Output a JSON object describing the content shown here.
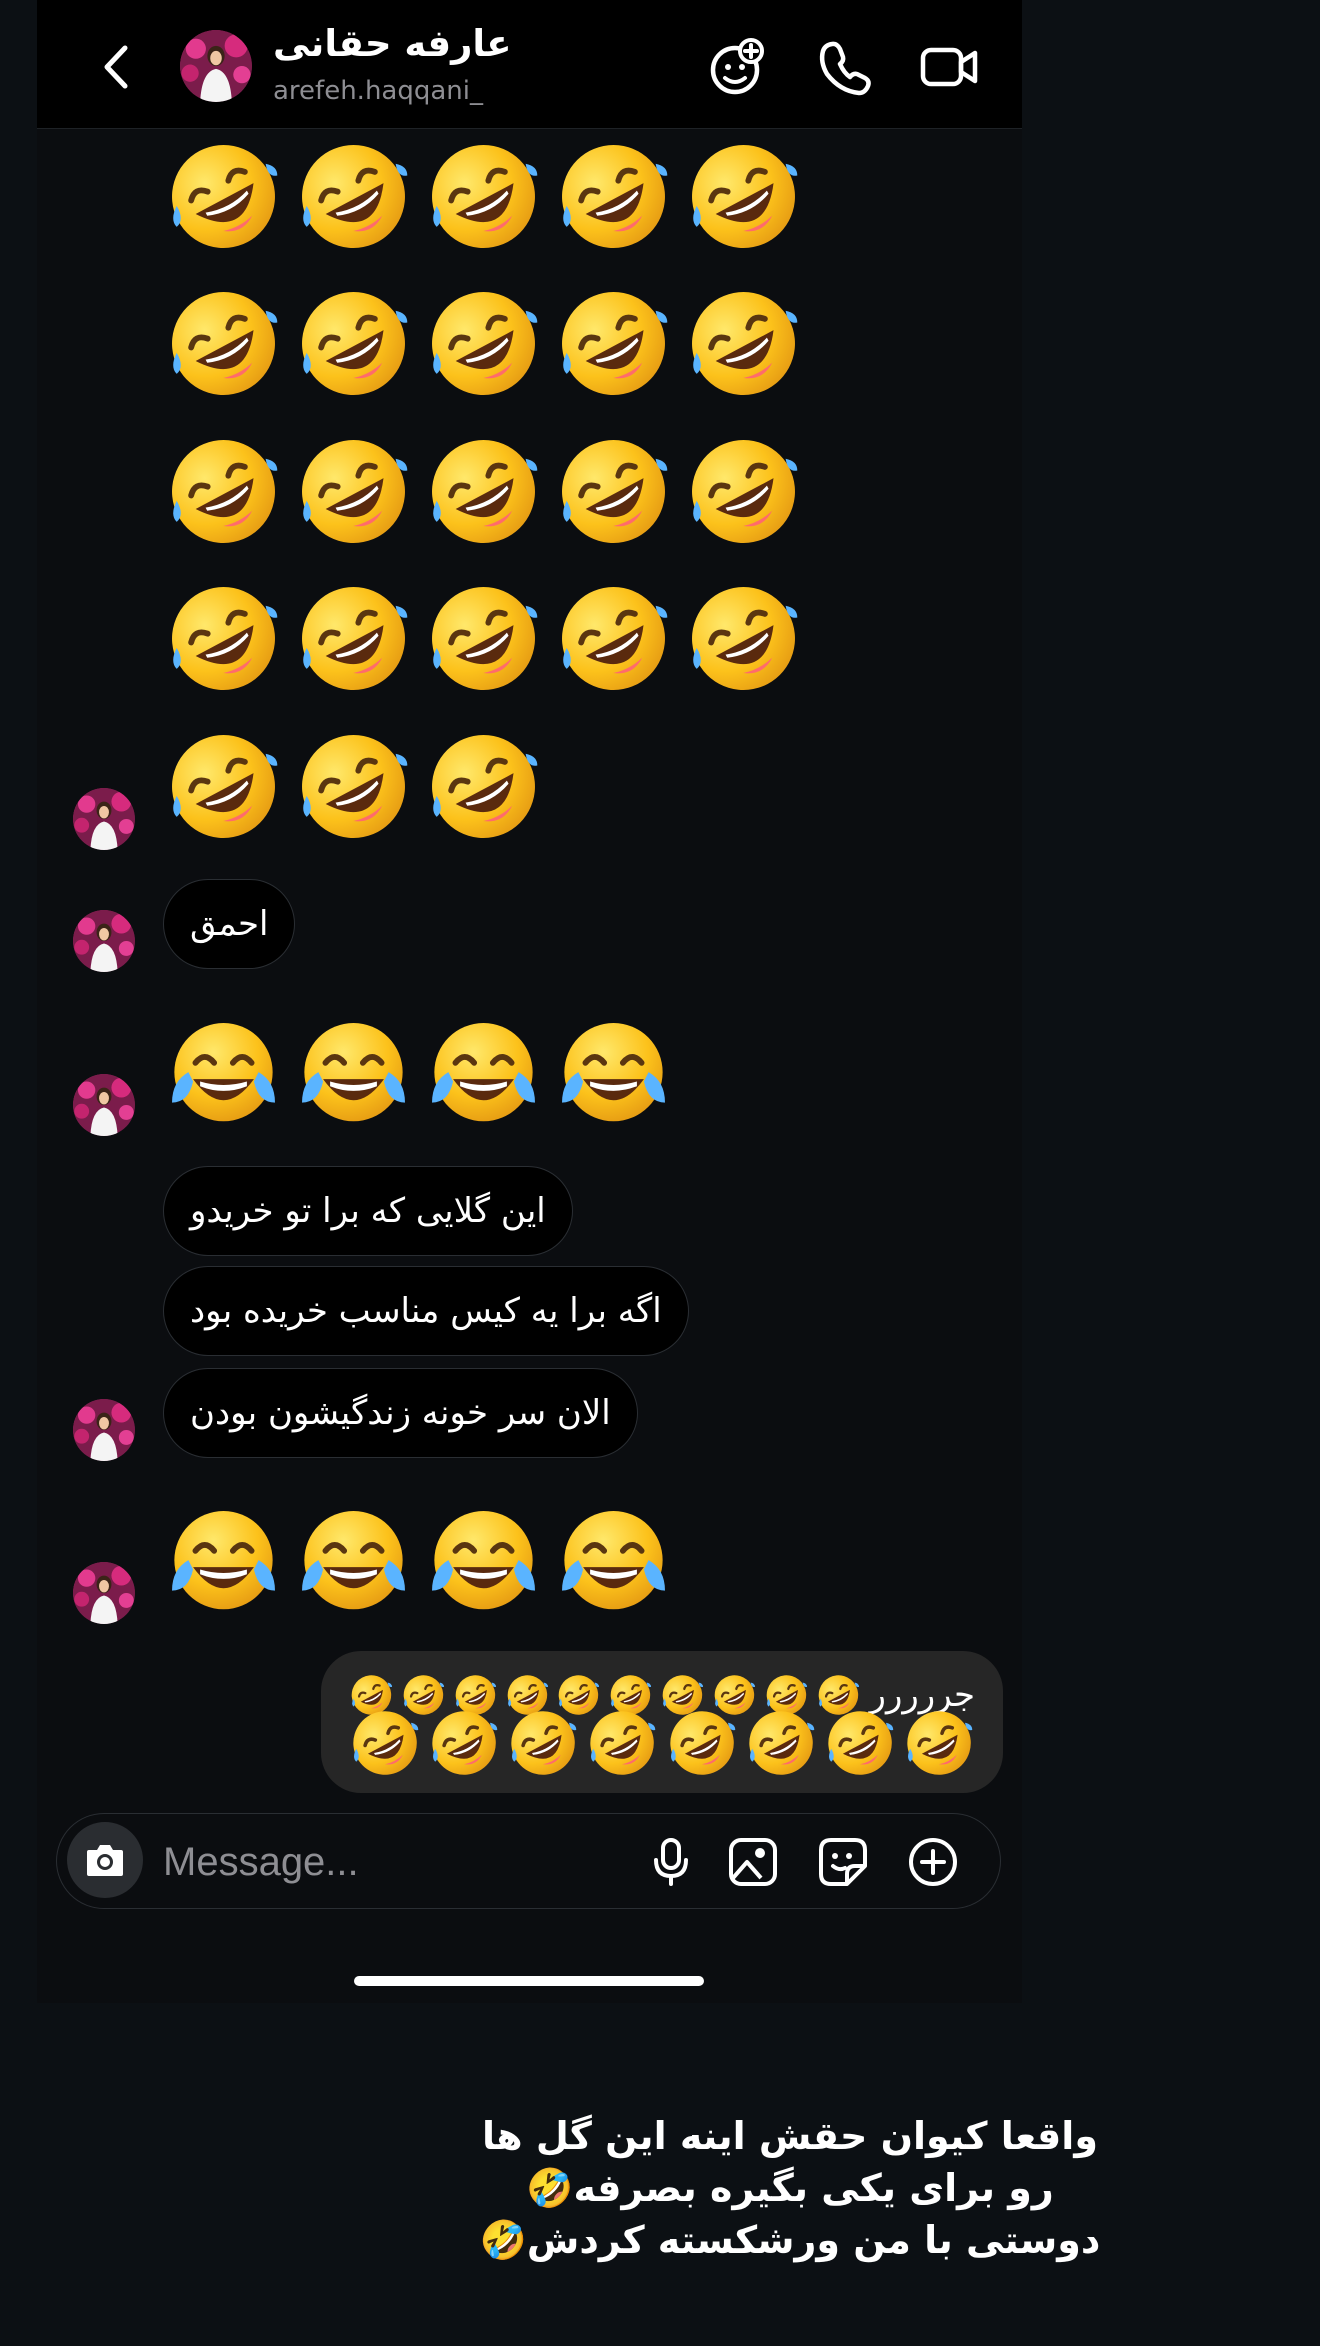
{
  "header": {
    "name": "عارفه حقانی",
    "handle": "arefeh.haqqani_"
  },
  "emojis": {
    "rofl": "rolling-on-floor-laughing",
    "joy": "face-with-tears-of-joy"
  },
  "messages": [
    {
      "id": "rofl-block",
      "type": "emoji",
      "emoji": "rolling-on-floor-laughing",
      "count": 23
    },
    {
      "id": "m1",
      "type": "text",
      "text": "احمق"
    },
    {
      "id": "joy-1",
      "type": "emoji",
      "emoji": "face-with-tears-of-joy",
      "count": 4
    },
    {
      "id": "m2",
      "type": "text",
      "text": "این گلایی که برا تو خریدو"
    },
    {
      "id": "m3",
      "type": "text",
      "text": "اگه برا یه کیس مناسب خریده بود"
    },
    {
      "id": "m4",
      "type": "text",
      "text": "الان سر خونه زندگیشون بودن"
    },
    {
      "id": "joy-2",
      "type": "emoji",
      "emoji": "face-with-tears-of-joy",
      "count": 4
    },
    {
      "id": "out1",
      "type": "outgoing",
      "text": "جررررر",
      "emoji": "rolling-on-floor-laughing",
      "count": 18
    }
  ],
  "composer": {
    "placeholder": "Message..."
  },
  "caption": {
    "line1": "واقعا کیوان حقش اینه این گل ها",
    "line2": "رو برای یکی بگیره بصرفه🤣",
    "line3": "دوستی با من ورشکسته کردش🤣"
  },
  "colors": {
    "background": "#0c1014",
    "screen": "#0b0d10",
    "header": "#000000",
    "bubble_in_border": "#2a2e33",
    "bubble_out": "#262626",
    "handle_text": "#8e8e93"
  }
}
